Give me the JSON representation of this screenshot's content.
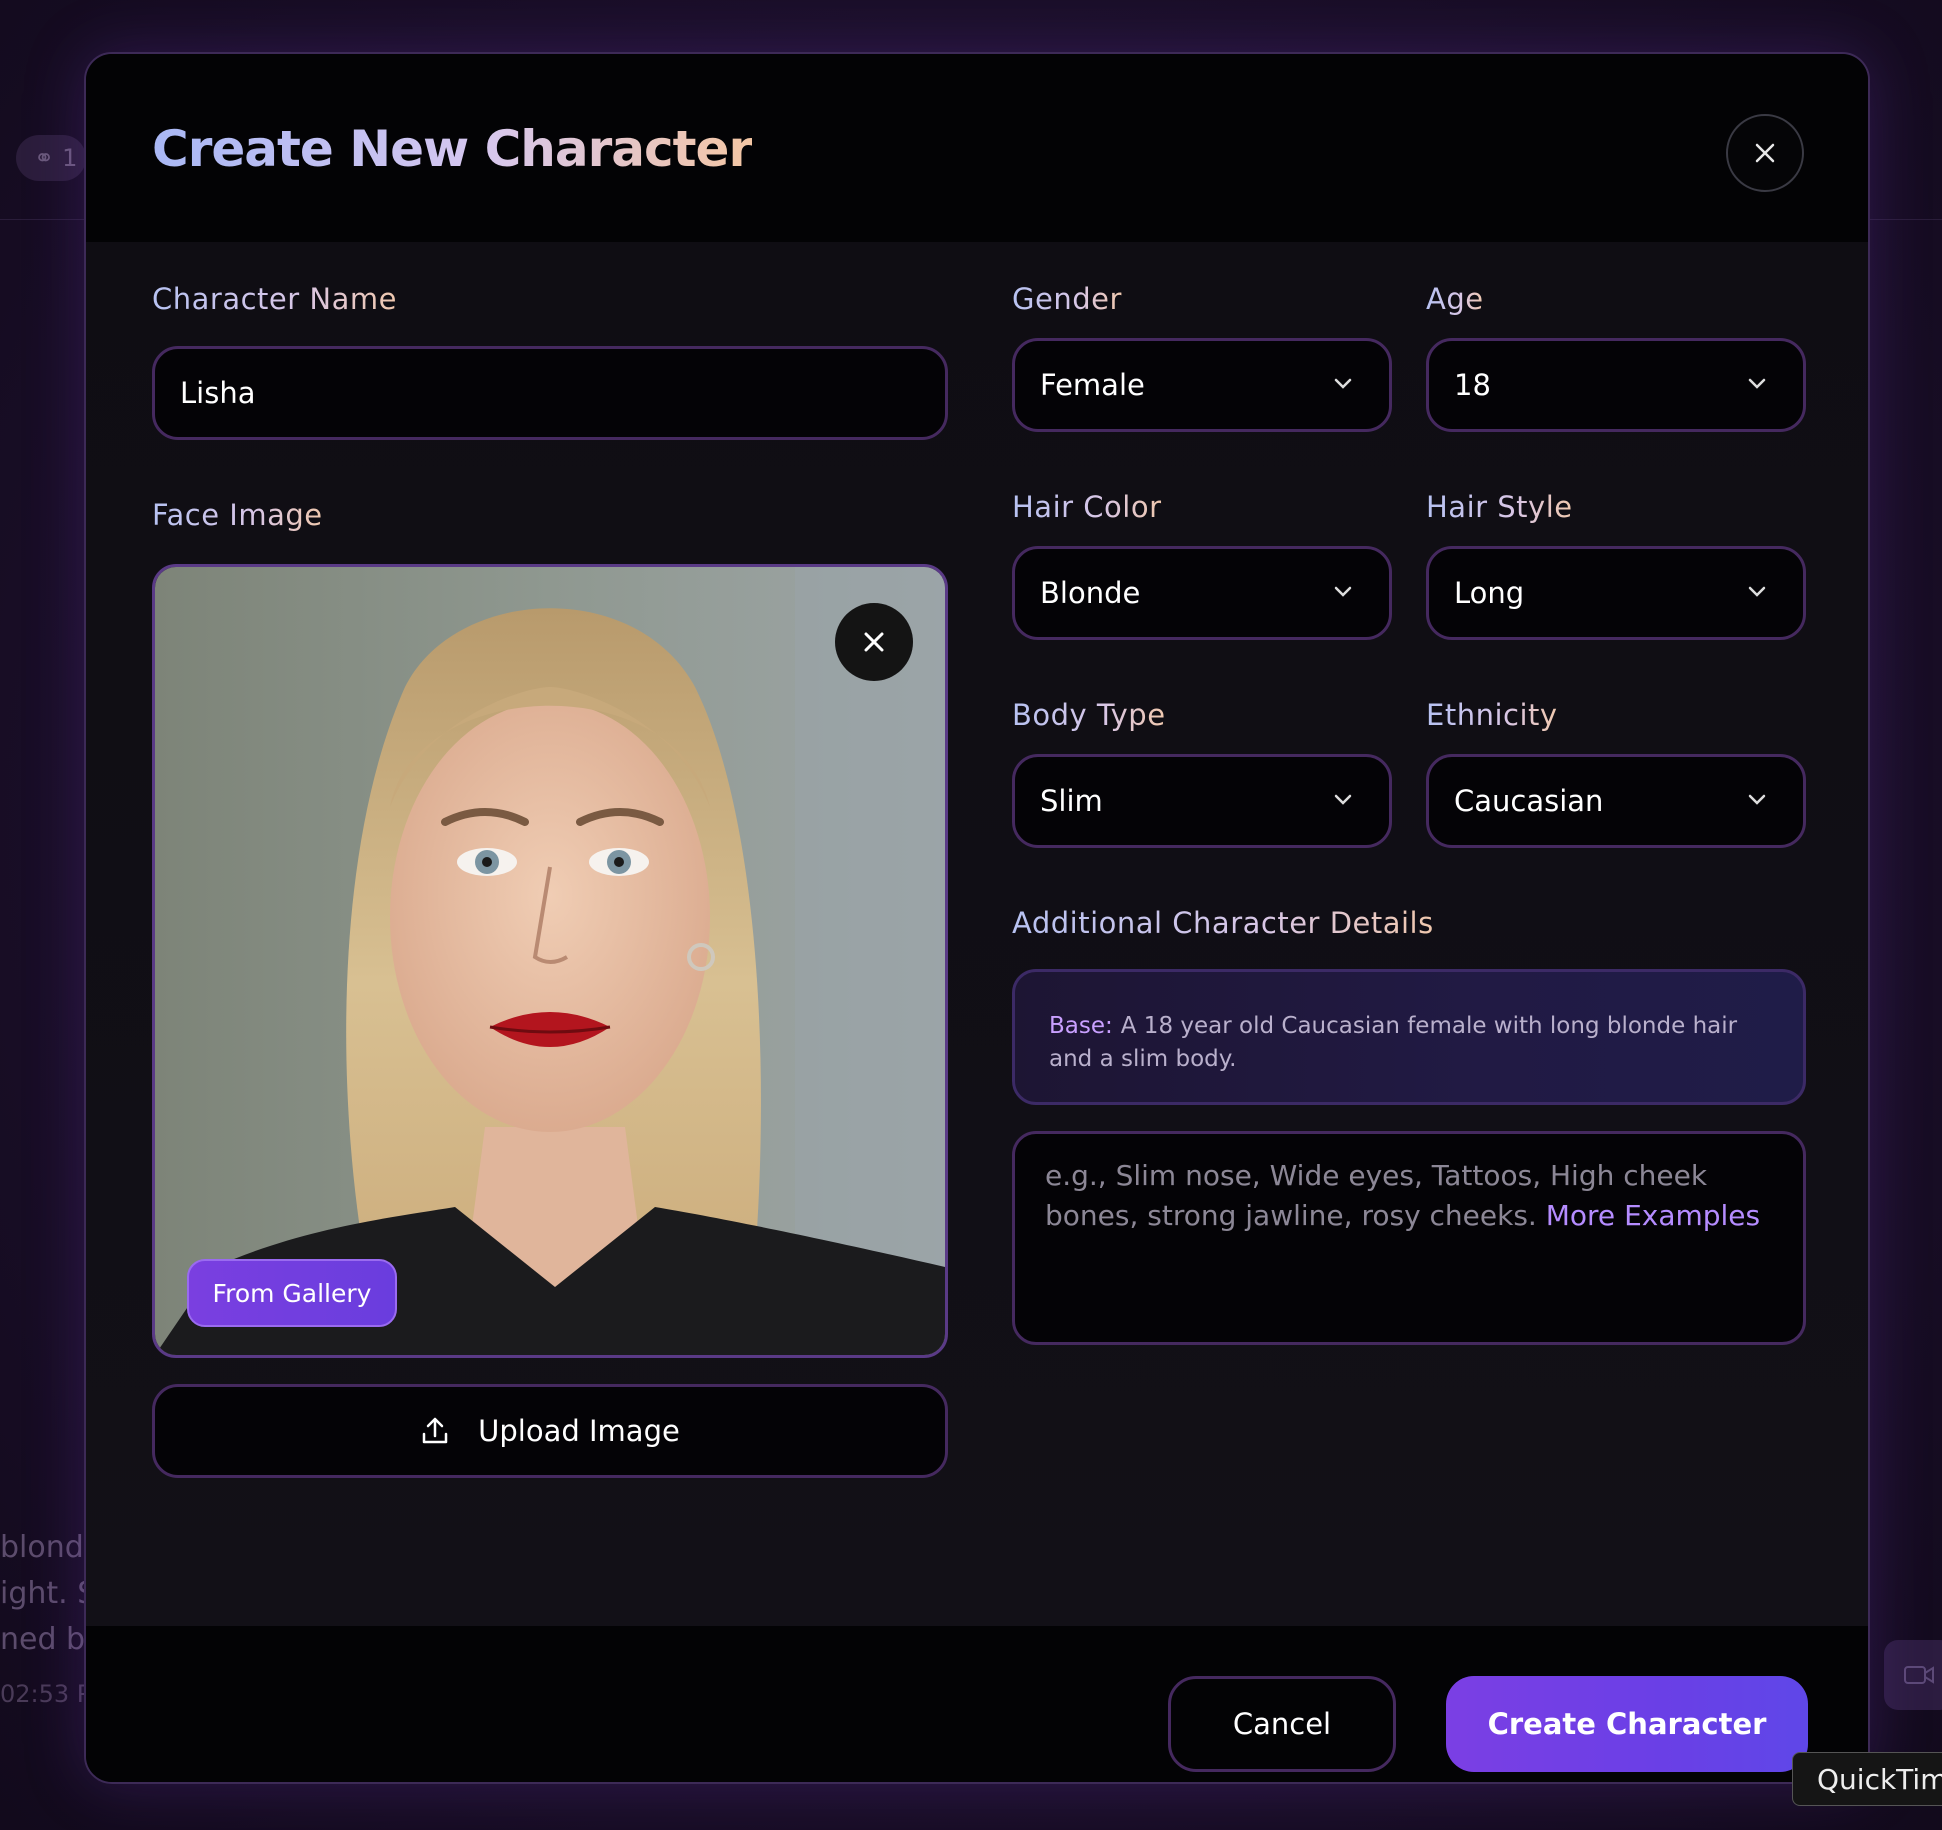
{
  "modal": {
    "title": "Create New Character"
  },
  "form": {
    "character_name_label": "Character Name",
    "character_name_value": "Lisha",
    "face_image_label": "Face Image",
    "from_gallery_label": "From Gallery",
    "upload_image_label": "Upload Image",
    "gender": {
      "label": "Gender",
      "value": "Female"
    },
    "age": {
      "label": "Age",
      "value": "18"
    },
    "hair_color": {
      "label": "Hair Color",
      "value": "Blonde"
    },
    "hair_style": {
      "label": "Hair Style",
      "value": "Long"
    },
    "body_type": {
      "label": "Body Type",
      "value": "Slim"
    },
    "ethnicity": {
      "label": "Ethnicity",
      "value": "Caucasian"
    },
    "additional_details_label": "Additional Character Details",
    "base_key": "Base:",
    "base_text": "A 18 year old Caucasian female with long blonde hair and a slim body.",
    "details_placeholder": "e.g., Slim nose, Wide eyes, Tattoos, High cheek bones, strong jawline, rosy cheeks.",
    "more_examples_label": "More Examples"
  },
  "footer": {
    "cancel_label": "Cancel",
    "create_label": "Create Character"
  },
  "background": {
    "chip_count": "1",
    "text_lines": [
      "blond",
      "ight. S",
      "ned by"
    ],
    "timestamp": "02:53 P",
    "tooltip": "QuickTime"
  },
  "icons": {
    "close": "close-icon",
    "chevron": "chevron-down-icon",
    "upload": "upload-icon"
  },
  "colors": {
    "accent": "#7b3fe4",
    "border": "#45295f",
    "link": "#b58cff"
  }
}
